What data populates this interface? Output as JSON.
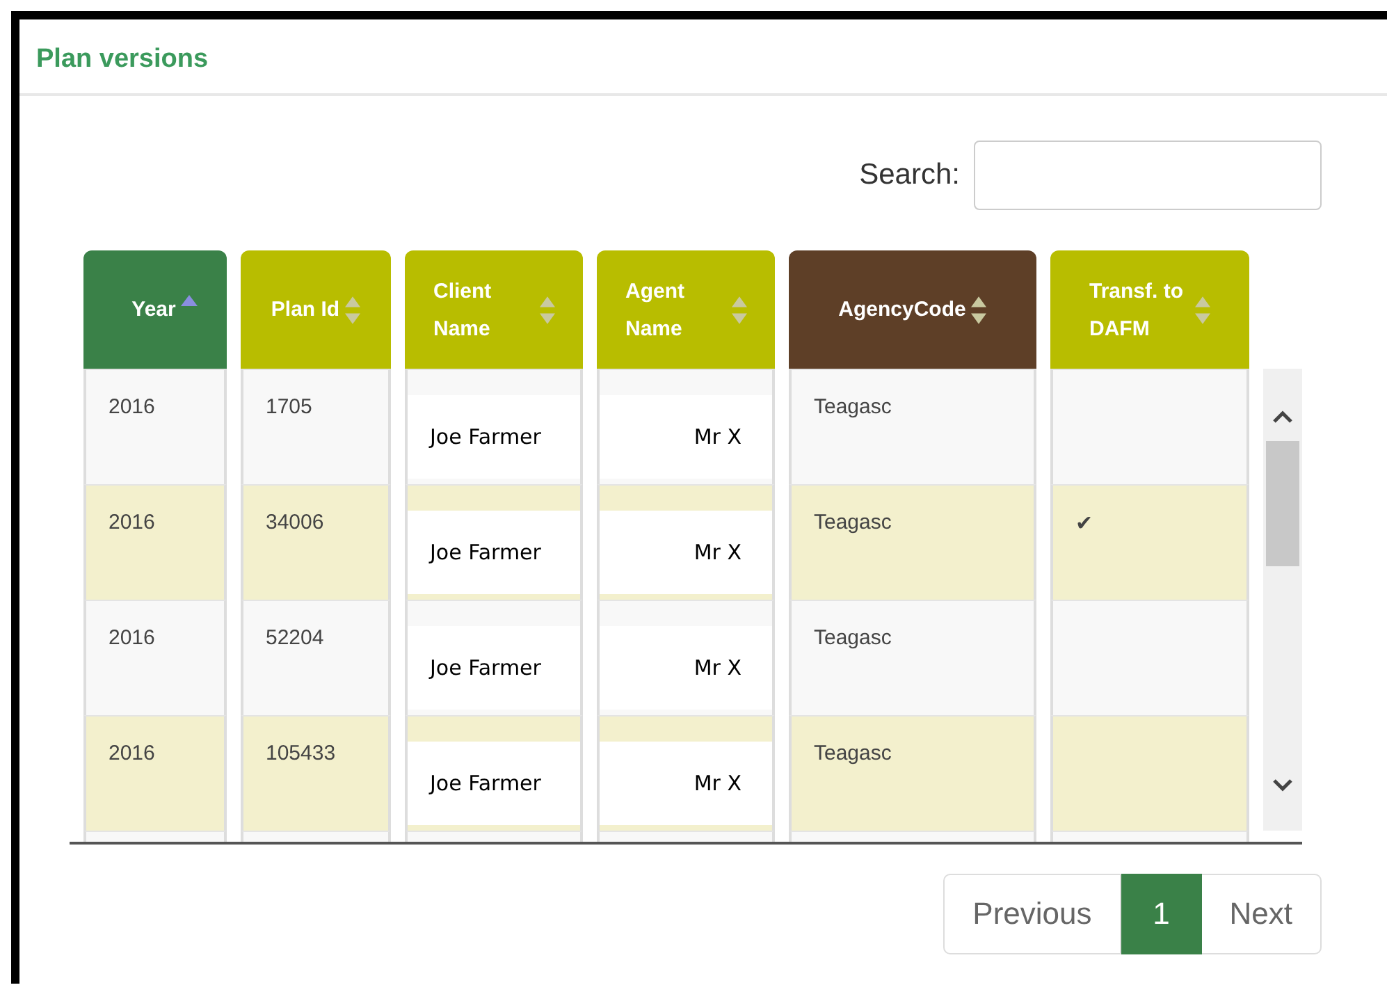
{
  "panel": {
    "title": "Plan versions"
  },
  "search": {
    "label": "Search:"
  },
  "table": {
    "columns": [
      {
        "label": "Year",
        "sorted": true,
        "color": "#3a8148"
      },
      {
        "label": "Plan Id",
        "sorted": false,
        "color": "#b8bd00"
      },
      {
        "label": "Client Name",
        "sorted": false,
        "color": "#b8bd00"
      },
      {
        "label": "Agent Name",
        "sorted": false,
        "color": "#b8bd00"
      },
      {
        "label": "AgencyCode",
        "sorted": false,
        "color": "#5e3f27"
      },
      {
        "label": "Transf. to DAFM",
        "sorted": false,
        "color": "#b8bd00"
      }
    ],
    "rows": [
      {
        "cells": [
          "2016",
          "1705",
          "Joe Farmer",
          "Mr X",
          "Teagasc",
          null
        ]
      },
      {
        "cells": [
          "2016",
          "34006",
          "Joe Farmer",
          "Mr X",
          "Teagasc",
          "✔"
        ]
      },
      {
        "cells": [
          "2016",
          "52204",
          "Joe Farmer",
          "Mr X",
          "Teagasc",
          null
        ]
      },
      {
        "cells": [
          "2016",
          "105433",
          "Joe Farmer",
          "Mr X",
          "Teagasc",
          null
        ]
      }
    ]
  },
  "pagination": [
    {
      "label": "Previous",
      "selected": false
    },
    {
      "label": "1",
      "selected": true
    },
    {
      "label": "Next",
      "selected": false
    }
  ]
}
